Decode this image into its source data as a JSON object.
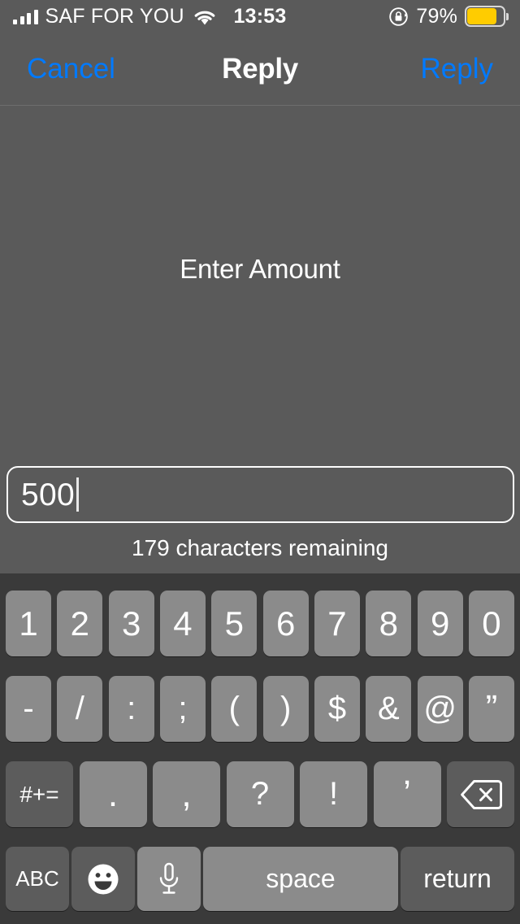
{
  "status_bar": {
    "signal_icon": "cellular-signal-icon",
    "signal_bars_filled": 4,
    "carrier": "SAF FOR YOU",
    "wifi_icon": "wifi-icon",
    "time": "13:53",
    "rotation_lock_icon": "rotation-lock-icon",
    "battery_percent": "79%",
    "battery_level": 79,
    "battery_color": "#ffcc00"
  },
  "nav_bar": {
    "cancel_label": "Cancel",
    "title": "Reply",
    "reply_label": "Reply",
    "accent_color": "#007aff"
  },
  "content": {
    "prompt": "Enter Amount",
    "input_value": "500",
    "input_placeholder": "",
    "characters_remaining": "179 characters remaining"
  },
  "keyboard": {
    "row1": [
      "1",
      "2",
      "3",
      "4",
      "5",
      "6",
      "7",
      "8",
      "9",
      "0"
    ],
    "row2": [
      "-",
      "/",
      ":",
      ";",
      "(",
      ")",
      "$",
      "&",
      "@",
      "”"
    ],
    "row3": {
      "modifier": "#+=",
      "keys": [
        ".",
        ",",
        "?",
        "!",
        "’"
      ],
      "backspace_icon": "backspace-icon"
    },
    "row4": {
      "abc": "ABC",
      "emoji_icon": "emoji-smiley-icon",
      "mic_icon": "microphone-icon",
      "space": "space",
      "return": "return"
    }
  }
}
